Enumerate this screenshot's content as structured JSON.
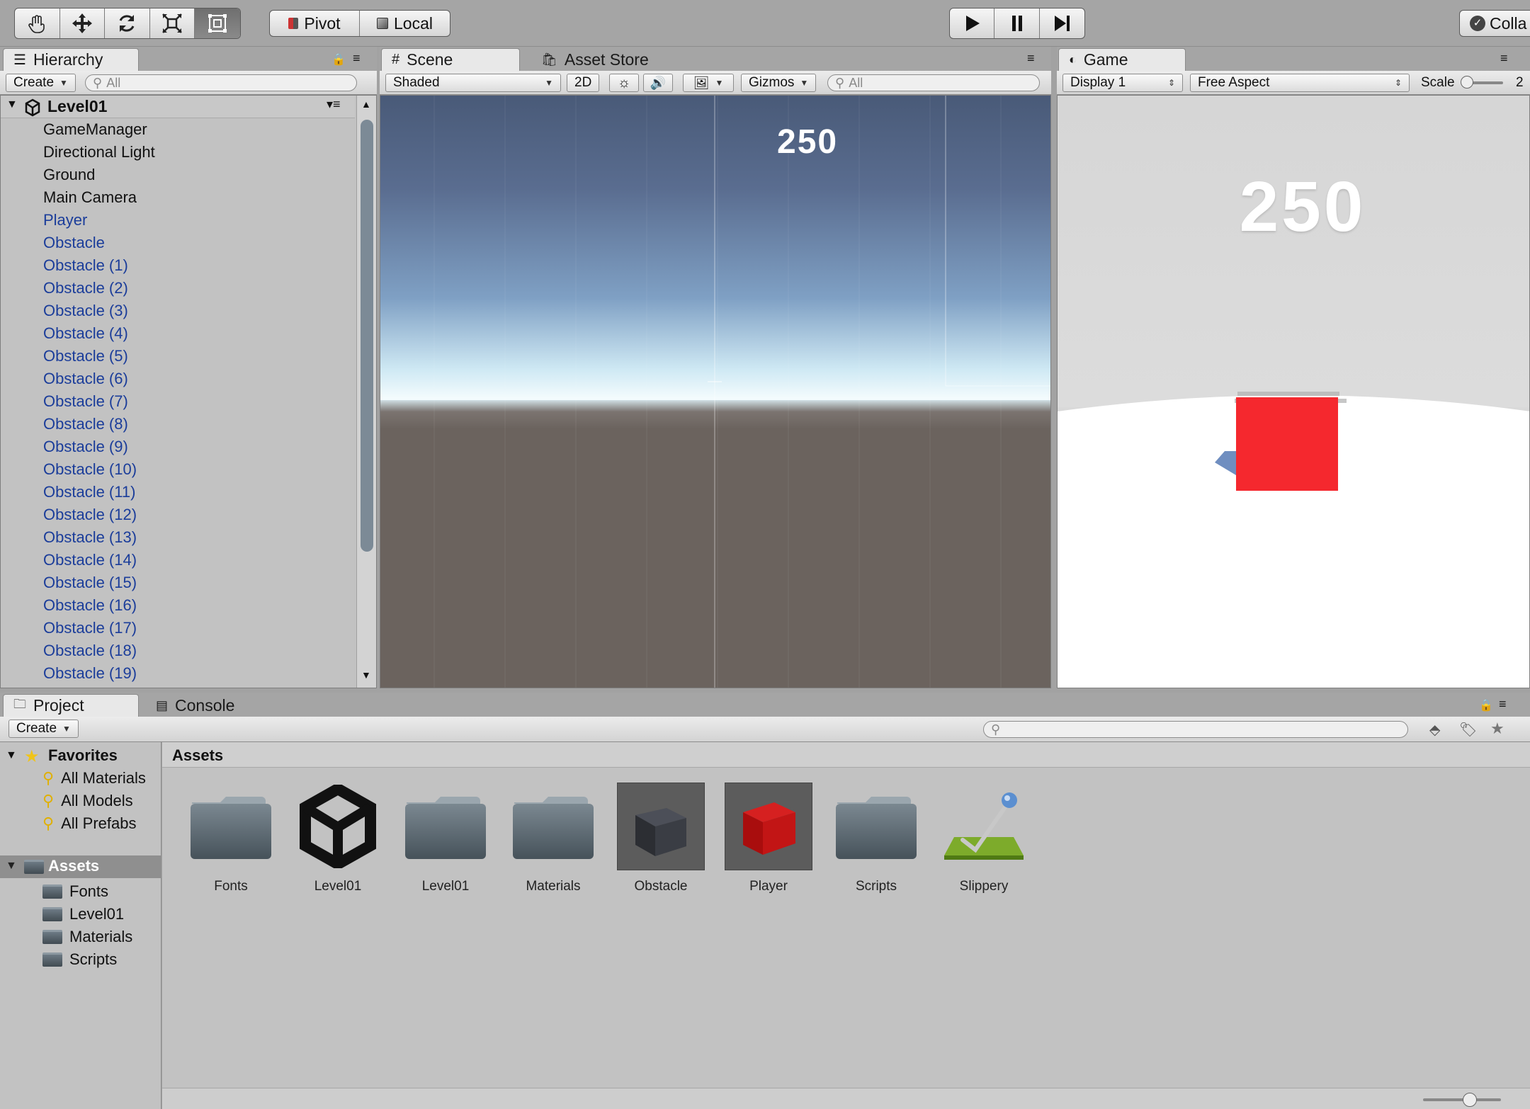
{
  "toolbar": {
    "pivot_label": "Pivot",
    "local_label": "Local",
    "collab_label": "Colla"
  },
  "hierarchy": {
    "tab_label": "Hierarchy",
    "create_label": "Create",
    "search_placeholder": "All",
    "scene_name": "Level01",
    "items": [
      {
        "label": "GameManager",
        "prefab": false
      },
      {
        "label": "Directional Light",
        "prefab": false
      },
      {
        "label": "Ground",
        "prefab": false
      },
      {
        "label": "Main Camera",
        "prefab": false
      },
      {
        "label": "Player",
        "prefab": true
      },
      {
        "label": "Obstacle",
        "prefab": true
      },
      {
        "label": "Obstacle (1)",
        "prefab": true
      },
      {
        "label": "Obstacle (2)",
        "prefab": true
      },
      {
        "label": "Obstacle (3)",
        "prefab": true
      },
      {
        "label": "Obstacle (4)",
        "prefab": true
      },
      {
        "label": "Obstacle (5)",
        "prefab": true
      },
      {
        "label": "Obstacle (6)",
        "prefab": true
      },
      {
        "label": "Obstacle (7)",
        "prefab": true
      },
      {
        "label": "Obstacle (8)",
        "prefab": true
      },
      {
        "label": "Obstacle (9)",
        "prefab": true
      },
      {
        "label": "Obstacle (10)",
        "prefab": true
      },
      {
        "label": "Obstacle (11)",
        "prefab": true
      },
      {
        "label": "Obstacle (12)",
        "prefab": true
      },
      {
        "label": "Obstacle (13)",
        "prefab": true
      },
      {
        "label": "Obstacle (14)",
        "prefab": true
      },
      {
        "label": "Obstacle (15)",
        "prefab": true
      },
      {
        "label": "Obstacle (16)",
        "prefab": true
      },
      {
        "label": "Obstacle (17)",
        "prefab": true
      },
      {
        "label": "Obstacle (18)",
        "prefab": true
      },
      {
        "label": "Obstacle (19)",
        "prefab": true
      }
    ]
  },
  "scene": {
    "tab_label": "Scene",
    "asset_store_tab": "Asset Store",
    "shading_mode": "Shaded",
    "mode_2d": "2D",
    "gizmos_label": "Gizmos",
    "search_placeholder": "All",
    "score_text": "250"
  },
  "game": {
    "tab_label": "Game",
    "display": "Display 1",
    "aspect": "Free Aspect",
    "scale_label": "Scale",
    "scale_value": "2",
    "score_text": "250"
  },
  "project": {
    "tab_label": "Project",
    "console_tab": "Console",
    "create_label": "Create",
    "favorites_label": "Favorites",
    "favorites": [
      "All Materials",
      "All Models",
      "All Prefabs"
    ],
    "assets_root": "Assets",
    "asset_folders": [
      "Fonts",
      "Level01",
      "Materials",
      "Scripts"
    ],
    "breadcrumb": "Assets",
    "assets": [
      {
        "label": "Fonts",
        "icon": "folder-icon"
      },
      {
        "label": "Level01",
        "icon": "unity-scene-icon"
      },
      {
        "label": "Level01",
        "icon": "folder-icon"
      },
      {
        "label": "Materials",
        "icon": "folder-icon"
      },
      {
        "label": "Obstacle",
        "icon": "dark-cube-prefab-icon"
      },
      {
        "label": "Player",
        "icon": "red-cube-prefab-icon"
      },
      {
        "label": "Scripts",
        "icon": "folder-icon"
      },
      {
        "label": "Slippery",
        "icon": "physics-material-icon"
      }
    ]
  },
  "colors": {
    "prefab_text": "#1b3d9a",
    "player_red": "#f5282e",
    "ground_brown": "#6b635e",
    "sky_top": "#485a78"
  }
}
